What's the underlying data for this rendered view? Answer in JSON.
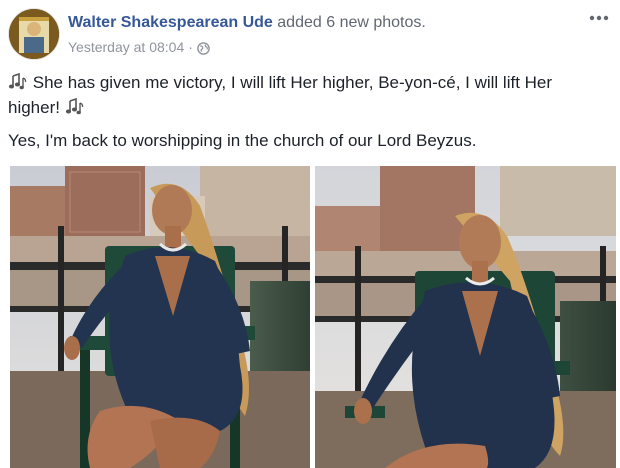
{
  "post": {
    "author_name": "Walter Shakespearean Ude",
    "action_text": "added 6 new photos.",
    "timestamp": "Yesterday at 08:04",
    "separator": "·",
    "privacy_icon": "globe-icon",
    "more_icon": "more-options-icon",
    "body_line1": "She has given me victory, I will lift Her higher, Be-yon-cé, I will lift Her higher!",
    "body_line2": "Yes, I'm back to worshipping in the church of our Lord Beyzus.",
    "emoji_icon": "musical-notes-icon"
  },
  "photos": [
    {
      "name": "photo-1",
      "description_icon": "photo"
    },
    {
      "name": "photo-2",
      "description_icon": "photo"
    }
  ],
  "colors": {
    "link": "#365899",
    "secondary_text": "#616770",
    "meta_text": "#90949c",
    "body_text": "#1d2129"
  }
}
